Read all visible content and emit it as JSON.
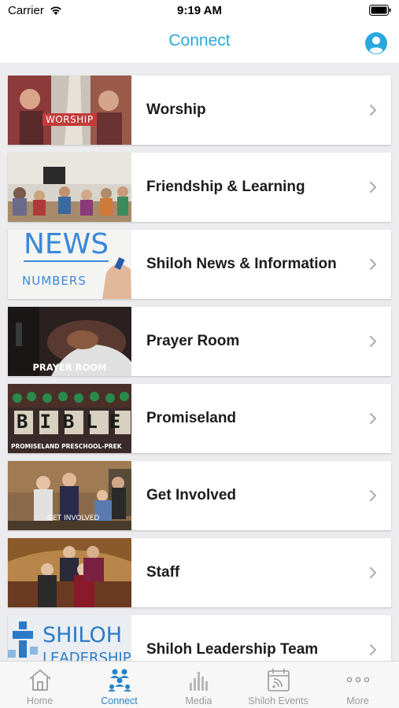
{
  "status_bar": {
    "carrier": "Carrier",
    "time": "9:19 AM"
  },
  "nav": {
    "title": "Connect",
    "title_color": "#2aa8de"
  },
  "items": [
    {
      "label": "Worship",
      "thumb_text": "WORSHIP"
    },
    {
      "label": "Friendship & Learning",
      "thumb_text": ""
    },
    {
      "label": "Shiloh News & Information",
      "thumb_text": "NEWS",
      "thumb_text_2": "NUMBERS"
    },
    {
      "label": "Prayer Room",
      "thumb_text": "PRAYER ROOM"
    },
    {
      "label": "Promiseland",
      "thumb_text": "BIBLE",
      "thumb_text_2": "PROMISELAND PRESCHOOL-PREK"
    },
    {
      "label": "Get Involved",
      "thumb_text": "GET INVOLVED"
    },
    {
      "label": "Staff",
      "thumb_text": ""
    },
    {
      "label": "Shiloh Leadership Team",
      "thumb_text": "SHILOH",
      "thumb_text_2": "LEADERSHIP"
    }
  ],
  "tabs": [
    {
      "label": "Home",
      "icon": "home-icon",
      "active": false
    },
    {
      "label": "Connect",
      "icon": "connect-icon",
      "active": true
    },
    {
      "label": "Media",
      "icon": "media-icon",
      "active": false
    },
    {
      "label": "Shiloh Events",
      "icon": "calendar-rss-icon",
      "active": false
    },
    {
      "label": "More",
      "icon": "more-icon",
      "active": false
    }
  ],
  "colors": {
    "accent": "#2aa8de",
    "tab_active": "#2383c8",
    "tab_inactive": "#9a9a9a"
  }
}
